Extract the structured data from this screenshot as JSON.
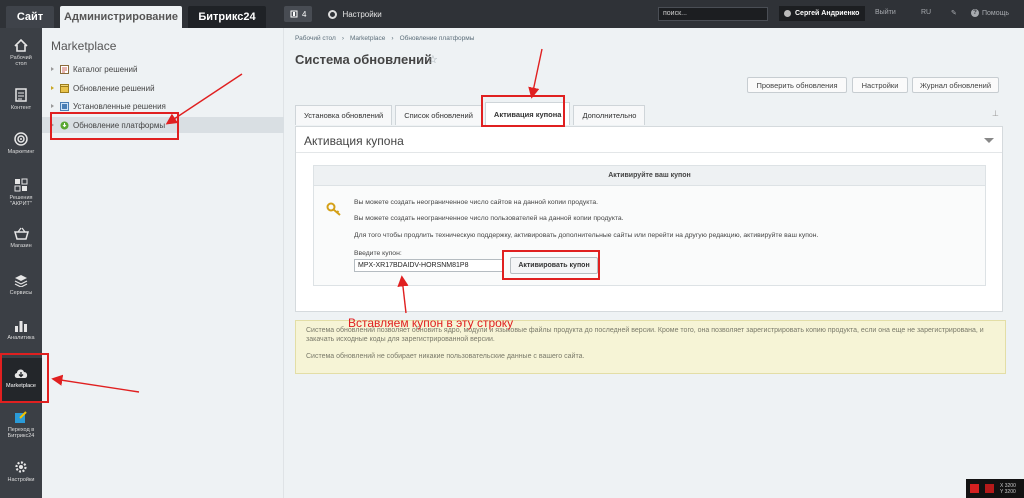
{
  "topbar": {
    "tab_site": "Сайт",
    "tab_admin": "Администрирование",
    "tab_b24": "Битрикс24",
    "notif_count": "4",
    "settings": "Настройки",
    "search_placeholder": "поиск...",
    "user_name": "Сергей Андриенко",
    "logout": "Выйти",
    "lang": "RU",
    "help": "Помощь"
  },
  "rail": {
    "items": [
      {
        "label": "Рабочий стол"
      },
      {
        "label": "Контент"
      },
      {
        "label": "Маркетинг"
      },
      {
        "label": "Решения \"АКРИТ\""
      },
      {
        "label": "Магазин"
      },
      {
        "label": "Сервисы"
      },
      {
        "label": "Аналитика"
      },
      {
        "label": "Marketplace"
      },
      {
        "label": "Переход в Битрикс24"
      },
      {
        "label": "Настройки"
      }
    ]
  },
  "menu": {
    "title": "Marketplace",
    "items": [
      {
        "label": "Каталог решений"
      },
      {
        "label": "Обновление решений"
      },
      {
        "label": "Установленные решения"
      },
      {
        "label": "Обновление платформы"
      }
    ]
  },
  "breadcrumb": [
    "Рабочий стол",
    "Marketplace",
    "Обновление платформы"
  ],
  "page_title": "Система обновлений",
  "toolbar": {
    "check": "Проверить обновления",
    "settings": "Настройки",
    "log": "Журнал обновлений"
  },
  "tabs": [
    {
      "label": "Установка обновлений"
    },
    {
      "label": "Список обновлений"
    },
    {
      "label": "Активация купона"
    },
    {
      "label": "Дополнительно"
    }
  ],
  "panel": {
    "title": "Активация купона",
    "inner_title": "Активируйте ваш купон",
    "msg1": "Вы можете создать неограниченное число сайтов на данной копии продукта.",
    "msg2": "Вы можете создать неограниченное число пользователей на данной копии продукта.",
    "msg3": "Для того чтобы продлить техническую поддержку, активировать дополнительные сайты или перейти на другую редакцию, активируйте ваш купон.",
    "coupon_label": "Введите купон:",
    "coupon_value": "MPX-XR17BDAIDV-HORSNM81P8",
    "activate_button": "Активировать купон"
  },
  "note": {
    "p1": "Система обновлений позволяет обновить ядро, модули и языковые файлы продукта до последней версии. Кроме того, она позволяет зарегистрировать копию продукта, если она еще не зарегистрирована, и закачать исходные коды для зарегистрированной версии.",
    "p2": "Система обновлений не собирает никакие пользовательские данные с вашего сайта."
  },
  "annotation": {
    "text": "Вставляем купон в эту строку",
    "color": "#e02020"
  },
  "corner": {
    "x": "X 3200",
    "y": "Y 3200"
  },
  "colors": {
    "topbar": "#2f3237",
    "rail": "#3b3f45",
    "note_bg": "#f6f4d6"
  }
}
